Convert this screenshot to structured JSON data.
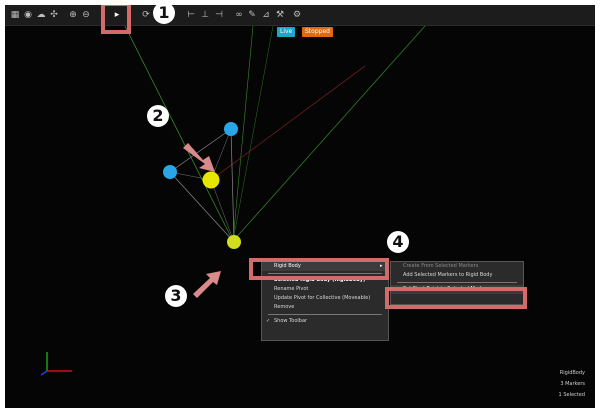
{
  "toolbar": {
    "icons": [
      "grid-icon",
      "eye-icon",
      "cloud-icon",
      "shapes-icon",
      "zoom-in-icon",
      "zoom-out-icon",
      "select-icon",
      "rotate-icon",
      "align-left-icon",
      "align-center-icon",
      "align-right-icon",
      "link-icon",
      "measure-icon",
      "rays-icon",
      "tools-icon",
      "settings-icon"
    ]
  },
  "viewport": {
    "badge_left": "Live",
    "badge_right": "Stopped",
    "status": [
      "RigidBody",
      "3 Markers",
      "1 Selected"
    ]
  },
  "context_menu": {
    "items": [
      {
        "label": "Rigid Body",
        "submenu": true
      },
      {
        "label": "Selected Rigid Body (RigidBody)"
      },
      {
        "label": "Rename Pivot"
      },
      {
        "label": "Update Pivot for Collective (Moveable)"
      },
      {
        "label": "Remove"
      },
      {
        "label": "Show Toolbar",
        "checked": true
      }
    ],
    "submenu": [
      "Create From Selected Markers",
      "Add Selected Markers to Rigid Body",
      "Set Pivot Point to Selected Marker"
    ]
  },
  "callouts": [
    "1",
    "2",
    "3",
    "4"
  ],
  "colors": {
    "accent_highlight": "#d36b6b",
    "marker_blue": "#2aa6e8",
    "marker_yellow": "#e6e600",
    "badge_live": "#1fa6c9",
    "badge_stop": "#e06a10"
  }
}
